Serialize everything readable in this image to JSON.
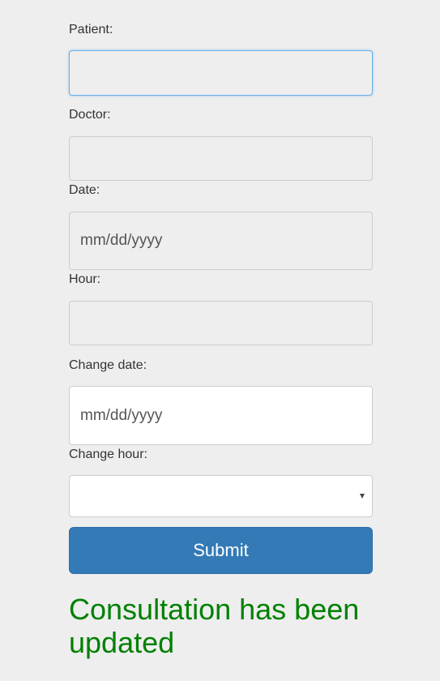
{
  "form": {
    "patient": {
      "label": "Patient:",
      "value": ""
    },
    "doctor": {
      "label": "Doctor:",
      "value": ""
    },
    "date": {
      "label": "Date:",
      "placeholder": "mm/dd/yyyy"
    },
    "hour": {
      "label": "Hour:",
      "value": ""
    },
    "change_date": {
      "label": "Change date:",
      "placeholder": "mm/dd/yyyy"
    },
    "change_hour": {
      "label": "Change hour:",
      "selected": ""
    },
    "submit_label": "Submit"
  },
  "status_message": "Consultation has been updated",
  "colors": {
    "primary": "#337ab7",
    "success_text": "#008000",
    "focus_border": "#66afe9",
    "background": "#eeeeee"
  },
  "icons": {
    "select_caret": "chevron-down-icon"
  }
}
